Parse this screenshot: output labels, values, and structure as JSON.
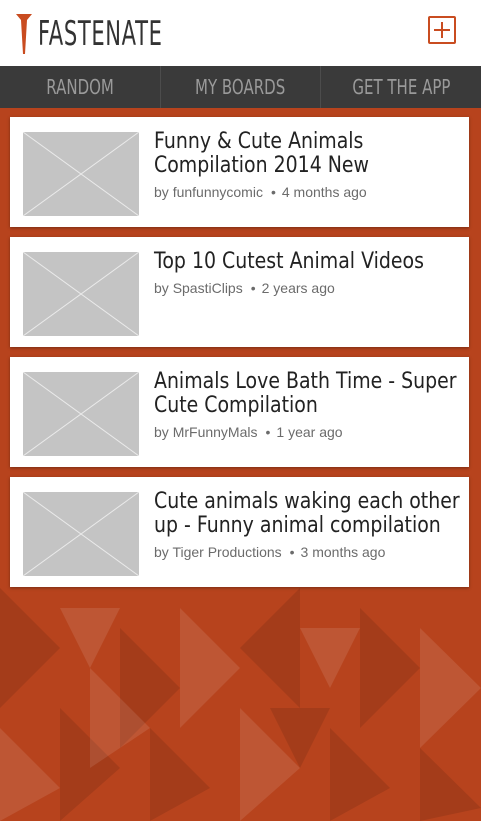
{
  "header": {
    "logo_text": "FASTENATE",
    "add_button_icon": "plus-icon",
    "accent_color": "#c94c20"
  },
  "nav": {
    "tabs": [
      {
        "label": "RANDOM"
      },
      {
        "label": "MY BOARDS"
      },
      {
        "label": "GET THE APP"
      }
    ]
  },
  "videos": [
    {
      "title": "Funny & Cute Animals Compilation 2014 New",
      "by": "by",
      "author": "funfunnycomic",
      "age": "4 months ago"
    },
    {
      "title": "Top 10 Cutest Animal Videos",
      "by": "by",
      "author": "SpastiClips",
      "age": "2 years ago"
    },
    {
      "title": "Animals Love Bath Time - Super Cute Compilation",
      "by": "by",
      "author": "MrFunnyMals",
      "age": "1 year ago"
    },
    {
      "title": "Cute animals waking each other up - Funny animal compilation",
      "by": "by",
      "author": "Tiger Productions",
      "age": "3 months ago"
    }
  ],
  "colors": {
    "background": "#b7431d",
    "nav": "#3a3a3a"
  }
}
